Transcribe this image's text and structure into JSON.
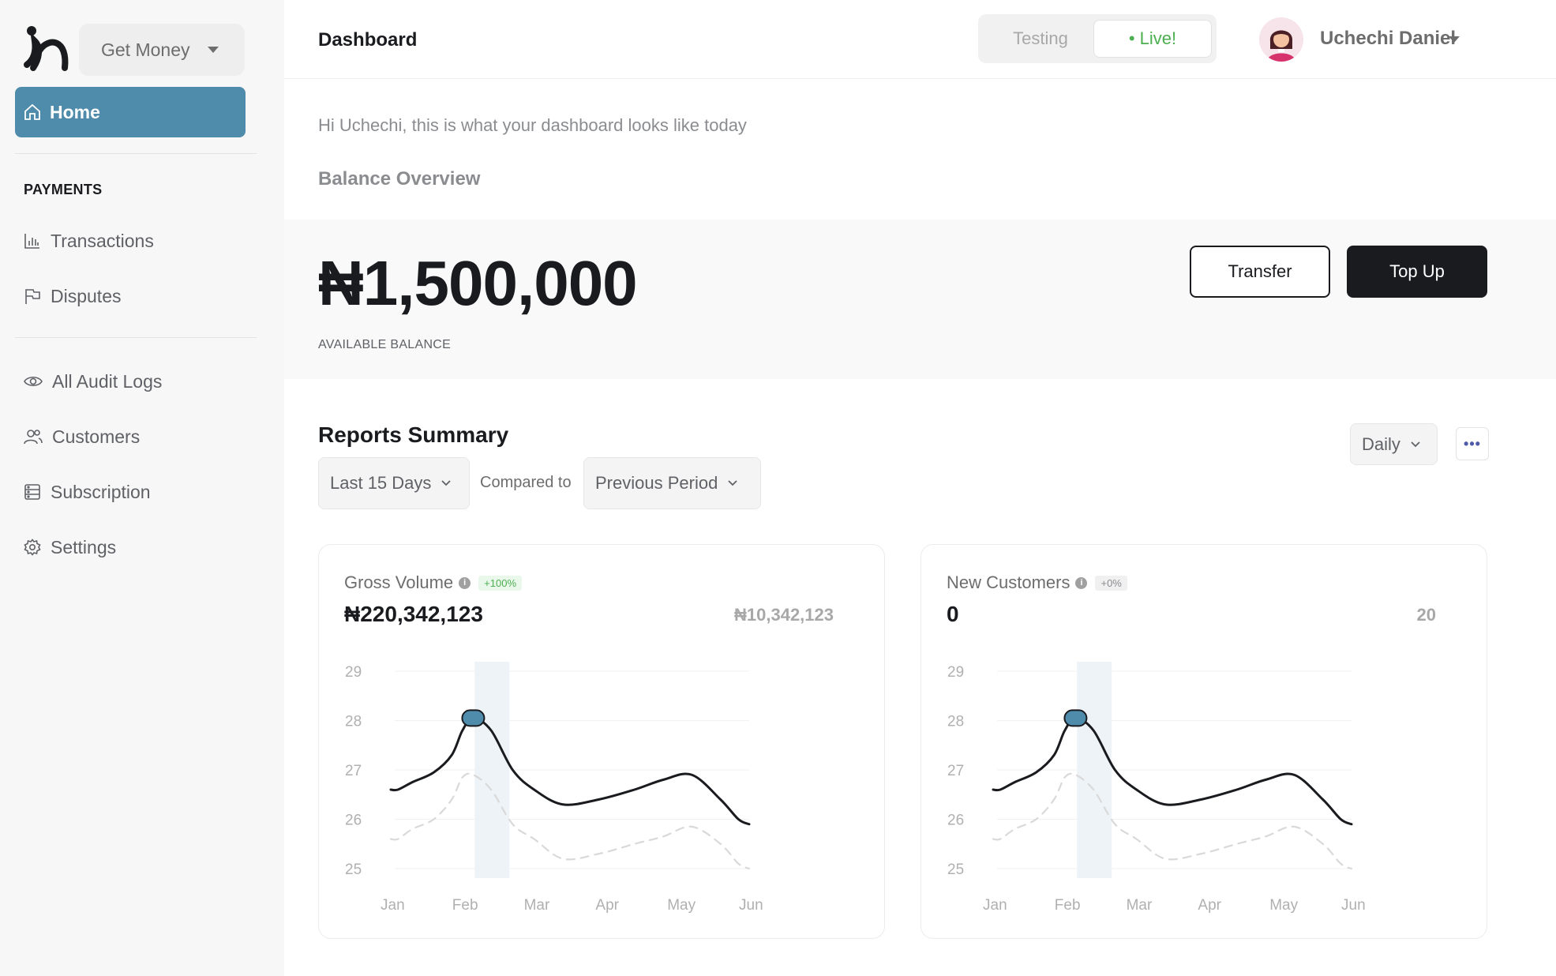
{
  "sidebar": {
    "workspace": "Get Money",
    "home_label": "Home",
    "section_label": "PAYMENTS",
    "items": [
      {
        "label": "Transactions",
        "icon": "bar-chart-icon"
      },
      {
        "label": "Disputes",
        "icon": "flag-icon"
      },
      {
        "label": "All Audit Logs",
        "icon": "eye-icon"
      },
      {
        "label": "Customers",
        "icon": "users-icon"
      },
      {
        "label": "Subscription",
        "icon": "stack-icon"
      },
      {
        "label": "Settings",
        "icon": "gear-icon"
      }
    ]
  },
  "header": {
    "title": "Dashboard",
    "mode_testing": "Testing",
    "mode_live": "• Live!",
    "user_name": "Uchechi Daniel"
  },
  "greeting": "Hi Uchechi, this is what your dashboard looks like today",
  "balance": {
    "title": "Balance Overview",
    "amount": "₦1,500,000",
    "label": "AVAILABLE BALANCE",
    "transfer_label": "Transfer",
    "topup_label": "Top Up"
  },
  "reports": {
    "title": "Reports Summary",
    "range": "Last 15 Days",
    "compared_label": "Compared to",
    "compare_period": "Previous Period",
    "interval": "Daily",
    "more": "•••"
  },
  "colors": {
    "accent": "#4f8bab",
    "dark": "#1a1b1f",
    "live": "#4caf50",
    "highlight_band": "#eef3f7"
  },
  "cards": [
    {
      "title": "Gross Volume",
      "badge": "+100%",
      "value": "₦220,342,123",
      "compare": "₦10,342,123"
    },
    {
      "title": "New Customers",
      "badge": "+0%",
      "value": "0",
      "compare": "20"
    }
  ],
  "chart_data": [
    {
      "type": "line",
      "title": "Gross Volume",
      "categories": [
        "Jan",
        "Feb",
        "Mar",
        "Apr",
        "May",
        "Jun"
      ],
      "x": [
        0,
        0.1,
        0.3,
        0.6,
        0.85,
        1.0,
        1.15,
        1.4,
        1.7,
        2.0,
        2.4,
        2.9,
        3.4,
        3.8,
        4.2,
        4.6,
        4.85,
        5.0
      ],
      "series": [
        {
          "values": [
            26.6,
            26.6,
            26.75,
            26.95,
            27.3,
            27.8,
            28.05,
            27.8,
            27.0,
            26.6,
            26.3,
            26.4,
            26.6,
            26.8,
            26.9,
            26.4,
            26.0,
            25.9
          ]
        },
        {
          "values": [
            25.6,
            25.6,
            25.8,
            26.0,
            26.4,
            26.85,
            26.9,
            26.6,
            25.9,
            25.6,
            25.2,
            25.3,
            25.5,
            25.65,
            25.85,
            25.5,
            25.1,
            25.0
          ]
        }
      ],
      "highlight": "Feb",
      "marker_index": 6,
      "yticks": [
        29,
        28,
        27,
        26,
        25
      ],
      "ylim": [
        25,
        29
      ]
    },
    {
      "type": "line",
      "title": "New Customers",
      "categories": [
        "Jan",
        "Feb",
        "Mar",
        "Apr",
        "May",
        "Jun"
      ],
      "x": [
        0,
        0.1,
        0.3,
        0.6,
        0.85,
        1.0,
        1.15,
        1.4,
        1.7,
        2.0,
        2.4,
        2.9,
        3.4,
        3.8,
        4.2,
        4.6,
        4.85,
        5.0
      ],
      "series": [
        {
          "values": [
            26.6,
            26.6,
            26.75,
            26.95,
            27.3,
            27.8,
            28.05,
            27.8,
            27.0,
            26.6,
            26.3,
            26.4,
            26.6,
            26.8,
            26.9,
            26.4,
            26.0,
            25.9
          ]
        },
        {
          "values": [
            25.6,
            25.6,
            25.8,
            26.0,
            26.4,
            26.85,
            26.9,
            26.6,
            25.9,
            25.6,
            25.2,
            25.3,
            25.5,
            25.65,
            25.85,
            25.5,
            25.1,
            25.0
          ]
        }
      ],
      "highlight": "Feb",
      "marker_index": 6,
      "yticks": [
        29,
        28,
        27,
        26,
        25
      ],
      "ylim": [
        25,
        29
      ]
    }
  ]
}
